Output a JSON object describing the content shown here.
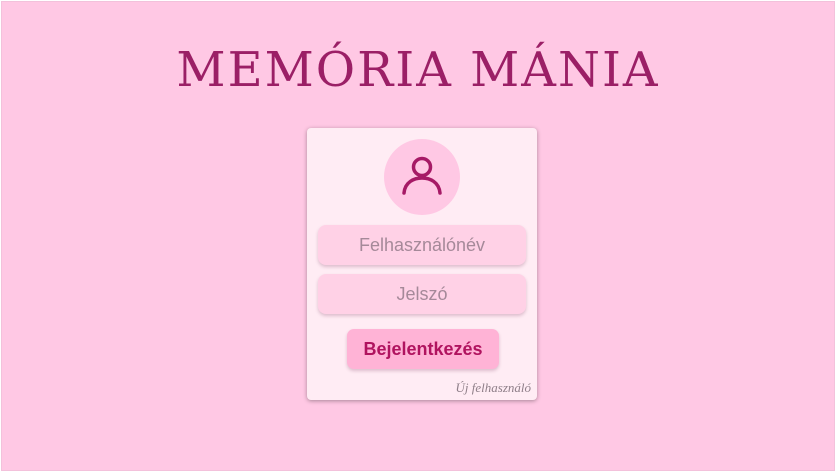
{
  "page": {
    "title": "MEMÓRIA MÁNIA",
    "background_color": "#ffc8e4",
    "title_color": "#9b1f66"
  },
  "login_card": {
    "avatar_icon": "user-icon",
    "username": {
      "placeholder": "Felhasználónév",
      "value": ""
    },
    "password": {
      "placeholder": "Jelszó",
      "value": ""
    },
    "submit_label": "Bejelentkezés",
    "new_user_link": "Új felhasználó"
  },
  "colors": {
    "card_bg": "#ffecf4",
    "input_bg": "#ffd1e6",
    "button_bg": "#ffb3d6",
    "button_text": "#b0135f",
    "icon_color": "#a61a66"
  }
}
